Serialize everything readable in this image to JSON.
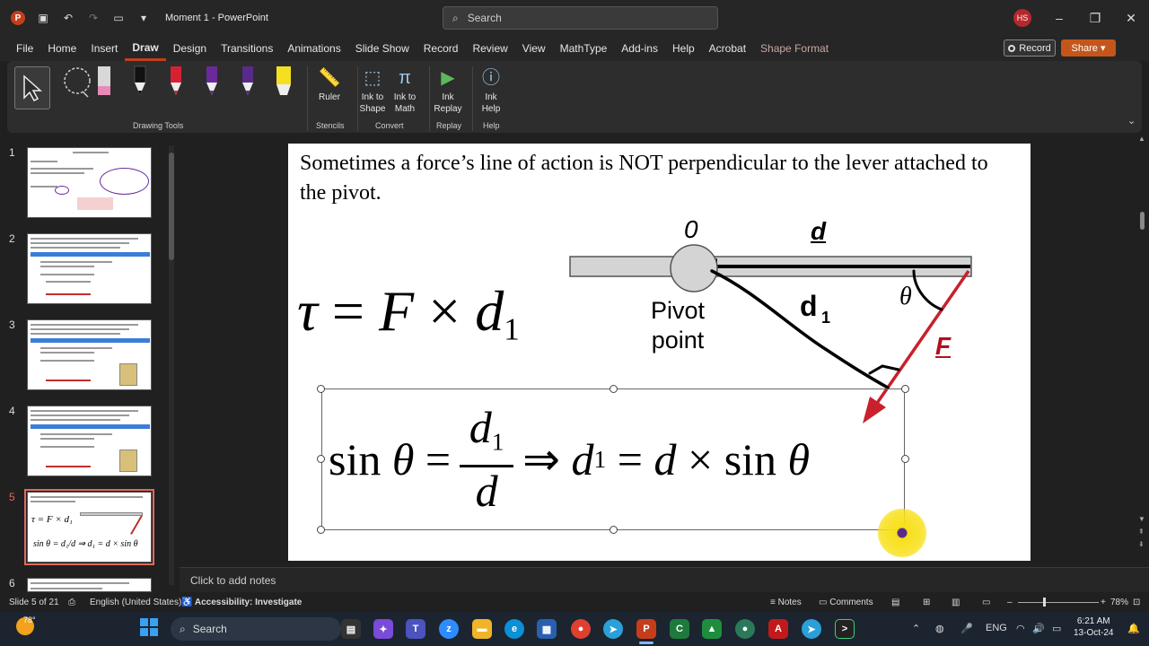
{
  "window": {
    "title": "Moment 1  -  PowerPoint",
    "app_logo": "P",
    "search_placeholder": "Search",
    "user_initials": "HS"
  },
  "menu": {
    "items": [
      "File",
      "Home",
      "Insert",
      "Draw",
      "Design",
      "Transitions",
      "Animations",
      "Slide Show",
      "Record",
      "Review",
      "View",
      "MathType",
      "Add-ins",
      "Help",
      "Acrobat",
      "Shape Format"
    ],
    "active": "Draw",
    "record_label": "Record",
    "share_label": "Share"
  },
  "ribbon": {
    "groups": {
      "drawing_tools": "Drawing Tools",
      "stencils": "Stencils",
      "convert": "Convert",
      "replay": "Replay",
      "help": "Help"
    },
    "buttons": {
      "ruler": "Ruler",
      "ink_to_shape_1": "Ink to",
      "ink_to_shape_2": "Shape",
      "ink_to_math_1": "Ink to",
      "ink_to_math_2": "Math",
      "ink_replay_1": "Ink",
      "ink_replay_2": "Replay",
      "ink_help_1": "Ink",
      "ink_help_2": "Help"
    },
    "pen_colors": [
      "#e88ab8",
      "#111111",
      "#d82030",
      "#6a2a9a",
      "#5a2a8a",
      "#f4e020"
    ]
  },
  "thumbnails": {
    "numbers": [
      "1",
      "2",
      "3",
      "4",
      "5",
      "6"
    ],
    "selected": "5"
  },
  "slide": {
    "text": "Sometimes a force’s line of action is NOT perpendicular to the lever attached to the pivot.",
    "formula1": {
      "tau": "τ",
      "eq": "=",
      "F": "F",
      "times": "×",
      "d": "d",
      "sub": "1"
    },
    "formula2": {
      "sin": "sin",
      "theta": "θ",
      "eq": "=",
      "num_d": "d",
      "num_sub": "1",
      "den_d": "d",
      "implies": "⇒",
      "d1": "d",
      "d1_sub": "1",
      "eq2": "=",
      "d": "d",
      "times": "×",
      "sin2": "sin",
      "theta2": "θ"
    },
    "label_o": "0",
    "label_d": "d",
    "label_pivot_1": "Pivot",
    "label_pivot_2": "point",
    "label_theta": "θ",
    "label_f": "F"
  },
  "notes_placeholder": "Click to add notes",
  "status": {
    "slide_counter": "Slide 5 of 21",
    "language": "English (United States)",
    "accessibility": "Accessibility: Investigate",
    "notes": "Notes",
    "comments": "Comments",
    "zoom": "78%"
  },
  "taskbar": {
    "weather": "78°",
    "search": "Search",
    "lang": "ENG",
    "time": "6:21 AM",
    "date": "13-Oct-24"
  }
}
